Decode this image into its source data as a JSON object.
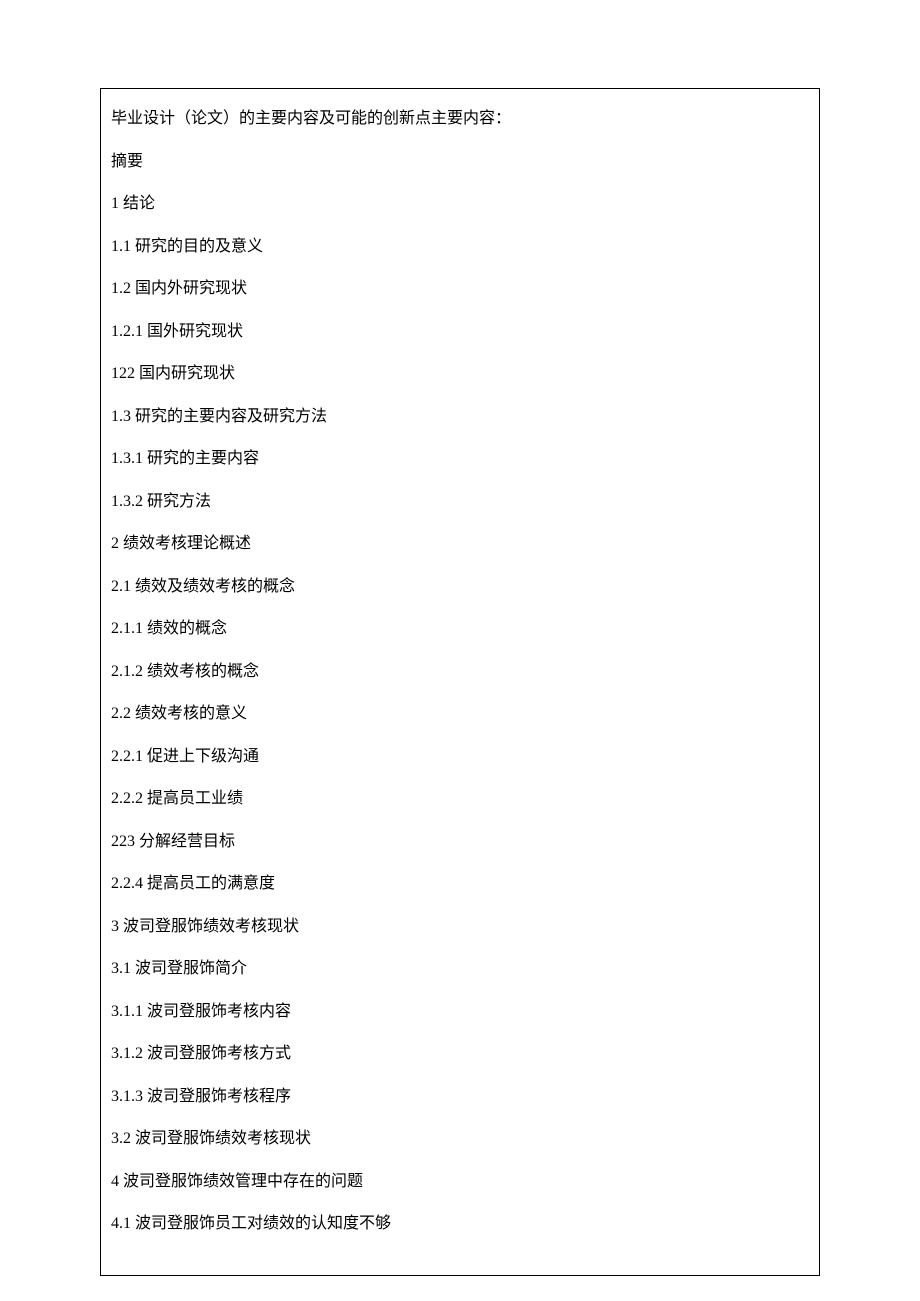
{
  "title": "毕业设计（论文）的主要内容及可能的创新点主要内容：",
  "lines": [
    "摘要",
    "1 结论",
    "1.1    研究的目的及意义",
    "1.2    国内外研究现状",
    "1.2.1   国外研究现状",
    "122 国内研究现状",
    "1.3    研究的主要内容及研究方法",
    "1.3.1   研究的主要内容",
    "1.3.2   研究方法",
    "2 绩效考核理论概述",
    "2.1    绩效及绩效考核的概念",
    "2.1.1   绩效的概念",
    "2.1.2   绩效考核的概念",
    "2.2    绩效考核的意义",
    "2.2.1   促进上下级沟通",
    "2.2.2   提高员工业绩",
    "223 分解经营目标",
    "2.2.4   提高员工的满意度",
    "3 波司登服饰绩效考核现状",
    "3.1    波司登服饰简介",
    "3.1.1   波司登服饰考核内容",
    "3.1.2   波司登服饰考核方式",
    "3.1.3   波司登服饰考核程序",
    "3.2    波司登服饰绩效考核现状",
    "4 波司登服饰绩效管理中存在的问题",
    "4.1    波司登服饰员工对绩效的认知度不够"
  ]
}
